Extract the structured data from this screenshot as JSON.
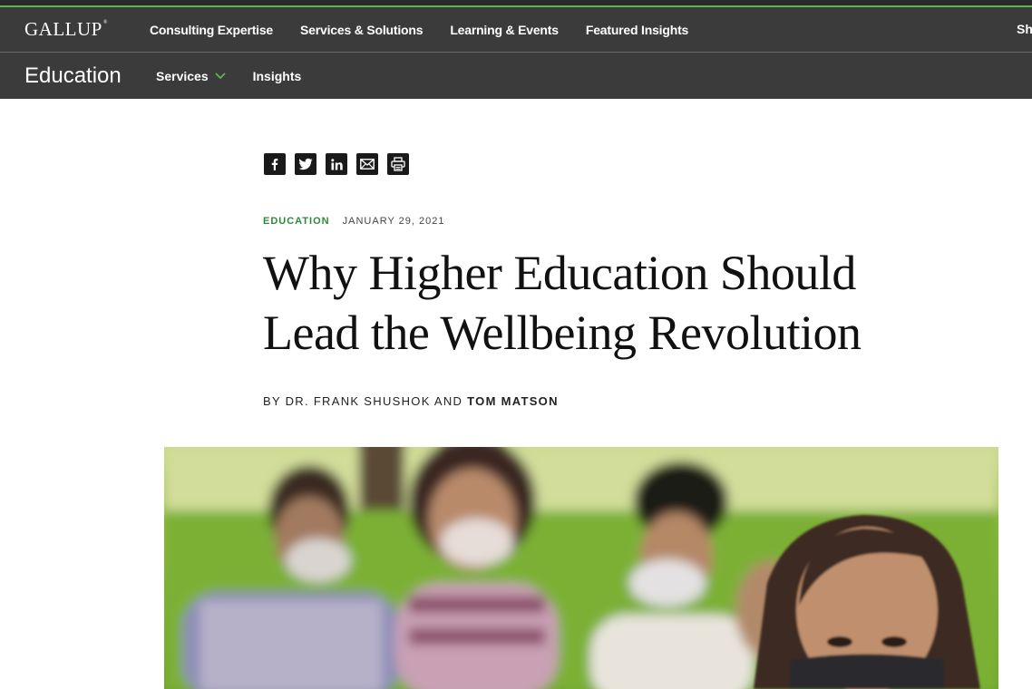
{
  "brand": {
    "logo_text": "GALLUP",
    "logo_mark": "®"
  },
  "nav": {
    "primary": [
      "Consulting Expertise",
      "Services & Solutions",
      "Learning & Events",
      "Featured Insights"
    ],
    "overflow_label": "Sh"
  },
  "subnav": {
    "section": "Education",
    "services_label": "Services",
    "insights_label": "Insights"
  },
  "share": [
    "facebook-icon",
    "twitter-icon",
    "linkedin-icon",
    "email-icon",
    "print-icon"
  ],
  "article": {
    "category": "EDUCATION",
    "date": "JANUARY 29, 2021",
    "headline_line1": "Why Higher Education Should",
    "headline_line2": "Lead the Wellbeing Revolution",
    "byline_prefix": "BY DR. FRANK SHUSHOK AND",
    "byline_author": "TOM MATSON"
  },
  "colors": {
    "nav_bg": "#3b3b3b",
    "accent_green": "#2c8a37",
    "chevron_green": "#5fb64f"
  }
}
